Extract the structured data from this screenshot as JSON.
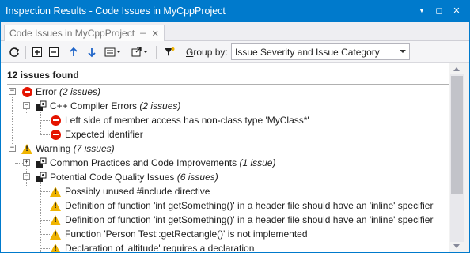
{
  "window": {
    "title": "Inspection Results - Code Issues in MyCppProject",
    "controls": {
      "dropdown": "▼",
      "restore": "◻",
      "close": "✕"
    }
  },
  "tab": {
    "label": "Code Issues in MyCppProject",
    "pin": "⊣",
    "close": "✕"
  },
  "toolbar": {
    "group_by_prefix": "",
    "group_by_label_underlined": "G",
    "group_by_label_rest": "roup by:",
    "group_by_value": "Issue Severity and Issue Category",
    "icons": [
      "refresh-icon",
      "expand-all-icon",
      "collapse-all-icon",
      "previous-icon",
      "next-icon",
      "export-icon",
      "open-in-icon",
      "filter-icon"
    ]
  },
  "summary": "12 issues found",
  "tree": {
    "error_group": {
      "label": "Error",
      "count": "(2 issues)"
    },
    "compiler_errors": {
      "label": "C++ Compiler Errors",
      "count": "(2 issues)"
    },
    "error_items": [
      "Left side of member access has non-class type 'MyClass*'",
      "Expected identifier"
    ],
    "warning_group": {
      "label": "Warning",
      "count": "(7 issues)"
    },
    "common_practices": {
      "label": "Common Practices and Code Improvements",
      "count": "(1 issue)"
    },
    "quality_issues": {
      "label": "Potential Code Quality Issues",
      "count": "(6 issues)"
    },
    "warning_items": [
      "Possibly unused #include directive",
      "Definition of function 'int getSomething()' in a header file should have an 'inline' specifier",
      "Definition of function 'int getSomething()' in a header file should have an 'inline' specifier",
      "Function 'Person Test::getRectangle()' is not implemented",
      "Declaration of 'altitude' requires a declaration"
    ]
  },
  "colors": {
    "titlebar": "#007acc",
    "error": "#e51400",
    "warning": "#f0b400"
  }
}
